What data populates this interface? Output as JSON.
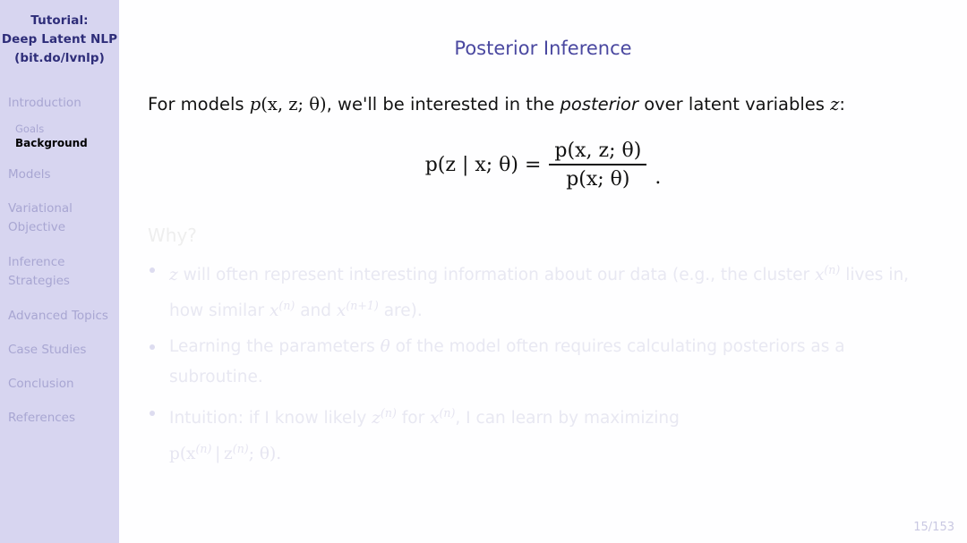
{
  "sidebar": {
    "title_lines": [
      "Tutorial:",
      "Deep Latent NLP",
      "(bit.do/lvnlp)"
    ],
    "sections": [
      {
        "label": "Introduction",
        "active": false
      },
      {
        "label": "Models",
        "active": false
      },
      {
        "label": "Variational",
        "active": false
      },
      {
        "label": "Objective",
        "active": false
      },
      {
        "label": "Inference",
        "active": false
      },
      {
        "label": "Strategies",
        "active": false
      },
      {
        "label": "Advanced Topics",
        "active": false
      },
      {
        "label": "Case Studies",
        "active": false
      },
      {
        "label": "Conclusion",
        "active": false
      },
      {
        "label": "References",
        "active": false
      }
    ],
    "subitems": [
      {
        "label": "Goals",
        "active": false
      },
      {
        "label": "Background",
        "active": true
      }
    ],
    "colors": {
      "background": "#d7d5f0",
      "title_text": "#2e2d79",
      "inactive_text": "#a8a6d2",
      "active_text": "#000000"
    }
  },
  "main": {
    "frame_title": "Posterior Inference",
    "lead": {
      "part1": "For models ",
      "math_p": "p",
      "math_args": "(x, z; θ)",
      "part2": ", we'll be interested in the ",
      "emphasis": "posterior",
      "part3": " over latent variables ",
      "math_z": "z",
      "part4": ":"
    },
    "equation": {
      "lhs": "p(z | x; θ)",
      "relation": "=",
      "numerator": "p(x, z; θ)",
      "denominator": "p(x; θ)",
      "trailing": "."
    },
    "faded_heading": "Why?",
    "bullets": [
      {
        "segments": [
          {
            "type": "math",
            "text": "z"
          },
          {
            "type": "text",
            "text": " will often represent interesting information about our data (e.g., the cluster "
          },
          {
            "type": "mathsup",
            "base": "x",
            "sup": "(n)"
          },
          {
            "type": "text",
            "text": " lives in, how similar "
          },
          {
            "type": "mathsup",
            "base": "x",
            "sup": "(n)"
          },
          {
            "type": "text",
            "text": " and "
          },
          {
            "type": "mathsup",
            "base": "x",
            "sup": "(n+1)"
          },
          {
            "type": "text",
            "text": " are)."
          }
        ],
        "plain": "z will often represent interesting information about our data (e.g., the cluster x(n) lives in, how similar x(n) and x(n+1) are)."
      },
      {
        "segments": [
          {
            "type": "text",
            "text": "Learning the parameters "
          },
          {
            "type": "math",
            "text": "θ"
          },
          {
            "type": "text",
            "text": " of the model often requires calculating posteriors as a subroutine."
          }
        ],
        "plain": "Learning the parameters θ of the model often requires calculating posteriors as a subroutine."
      },
      {
        "segments": [
          {
            "type": "text",
            "text": "Intuition: if I know likely "
          },
          {
            "type": "mathsup",
            "base": "z",
            "sup": "(n)"
          },
          {
            "type": "text",
            "text": " for "
          },
          {
            "type": "mathsup",
            "base": "x",
            "sup": "(n)"
          },
          {
            "type": "text",
            "text": ", I can learn by maximizing "
          },
          {
            "type": "mathblock",
            "text": "p(x(n) | z(n); θ)."
          }
        ],
        "plain": "Intuition: if I know likely z(n) for x(n), I can learn by maximizing p(x(n) | z(n); θ)."
      }
    ],
    "page_number": "15/153"
  }
}
